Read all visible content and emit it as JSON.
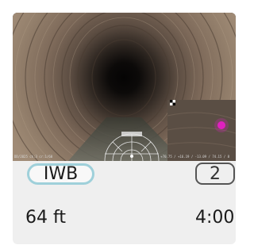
{
  "card": {
    "thumbnail": {
      "overlay_left": "DD/2025 ch:3 cr:1/60",
      "overlay_right": "+70.75 / +16.19 / -13.09 / 74.15 / 8",
      "pip_icon": "picture-in-picture-icon",
      "protractor_icon": "inclinometer-gauge-icon"
    },
    "tag_label": "IWB",
    "count_badge": "2",
    "distance": "64 ft",
    "duration": "4:00"
  },
  "colors": {
    "tag_border": "#9fd0da",
    "badge_border": "#555555",
    "marker": "#e020c0"
  }
}
